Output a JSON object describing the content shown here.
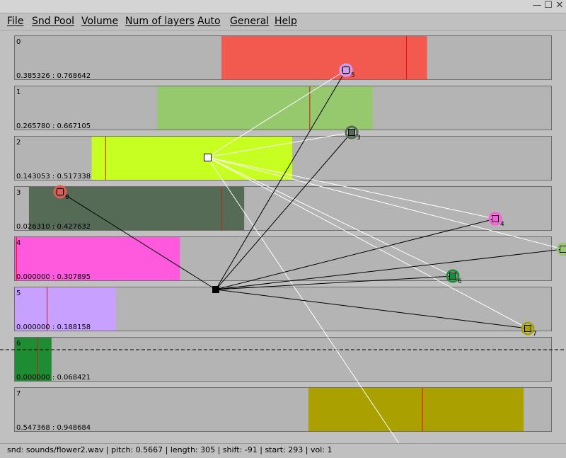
{
  "titlebar": {
    "minimize_glyph": "—",
    "maximize_glyph": "☐",
    "close_glyph": "✕"
  },
  "menu": [
    "File",
    "Snd Pool",
    "Volume",
    "Num of layers",
    "Auto",
    "General",
    "Help"
  ],
  "layers": [
    {
      "index": "0",
      "range_label": "0.385326 : 0.768642",
      "color": "#f25a50",
      "start": 0.3853,
      "end": 0.7686,
      "marker": 0.9
    },
    {
      "index": "1",
      "range_label": "0.265780 : 0.667105",
      "color": "#96c86e",
      "start": 0.2658,
      "end": 0.6671,
      "marker": 0.708
    },
    {
      "index": "2",
      "range_label": "0.143053 : 0.517338",
      "color": "#c8ff23",
      "start": 0.1431,
      "end": 0.5173,
      "marker": 0.07
    },
    {
      "index": "3",
      "range_label": "0.026310 : 0.427632",
      "color": "#556b55",
      "start": 0.0263,
      "end": 0.4276,
      "marker": 0.895
    },
    {
      "index": "4",
      "range_label": "0.000000 : 0.307895",
      "color": "#ff5ade",
      "start": 0.0,
      "end": 0.3079,
      "marker": 0.01
    },
    {
      "index": "5",
      "range_label": "0.000000 : 0.188158",
      "color": "#c8a0ff",
      "start": 0.0,
      "end": 0.1882,
      "marker": 0.32
    },
    {
      "index": "6",
      "range_label": "0.000000 : 0.068421",
      "color": "#1e8c32",
      "start": 0.0,
      "end": 0.0684,
      "marker": 0.62
    },
    {
      "index": "7",
      "range_label": "0.547368 : 0.948684",
      "color": "#aaa000",
      "start": 0.5474,
      "end": 0.9487,
      "marker": 0.53
    }
  ],
  "nodes": [
    {
      "label": "0",
      "color": "#e85a50"
    },
    {
      "label": "5",
      "color": "#c8a0ff"
    },
    {
      "label": "3",
      "color": "#556b55"
    },
    {
      "label": "4",
      "color": "#ff5ade"
    },
    {
      "label": "6",
      "color": "#1e8c32"
    },
    {
      "label": "7",
      "color": "#aaa000"
    },
    {
      "label": "",
      "color": "#96c86e"
    },
    {
      "label": "",
      "color": "#c8ff23"
    }
  ],
  "status": "snd: sounds/flower2.wav | pitch: 0.5667 | length: 305 | shift: -91 | start: 293 | vol: 1"
}
